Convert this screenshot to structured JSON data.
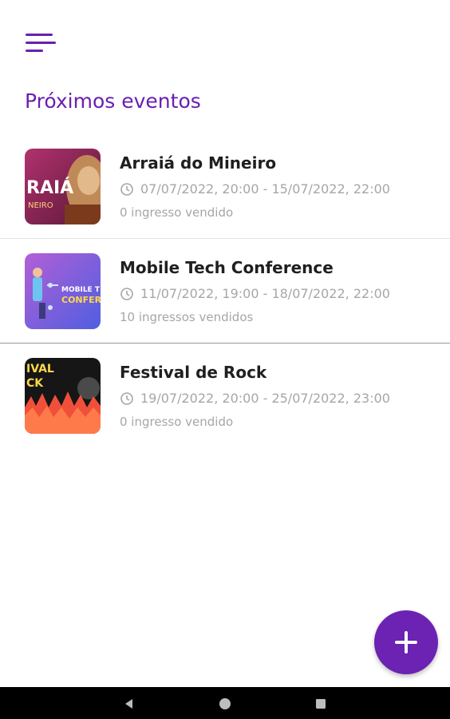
{
  "header": {
    "title": "Próximos eventos",
    "menu_icon": "menu-icon"
  },
  "events": [
    {
      "name": "Arraiá do Mineiro",
      "dates": "07/07/2022, 20:00 - 15/07/2022, 22:00",
      "sold": "0 ingresso vendido",
      "thumb_text_1": "RAIÁ",
      "thumb_text_2": "NEIRO"
    },
    {
      "name": "Mobile Tech Conference",
      "dates": "11/07/2022, 19:00 - 18/07/2022, 22:00",
      "sold": "10 ingressos vendidos",
      "thumb_text_1": "MOBILE T",
      "thumb_text_2": "CONFER"
    },
    {
      "name": "Festival de Rock",
      "dates": "19/07/2022, 20:00 - 25/07/2022, 23:00",
      "sold": "0 ingresso vendido",
      "thumb_text_1": "IVAL",
      "thumb_text_2": "CK"
    }
  ],
  "fab": {
    "icon": "plus-icon"
  },
  "navbar": {
    "back_icon": "back-triangle-icon",
    "home_icon": "home-circle-icon",
    "recents_icon": "recents-square-icon"
  },
  "colors": {
    "accent": "#6a1fb0",
    "muted": "#a6a6a6",
    "divider": "#e3e3e3"
  }
}
